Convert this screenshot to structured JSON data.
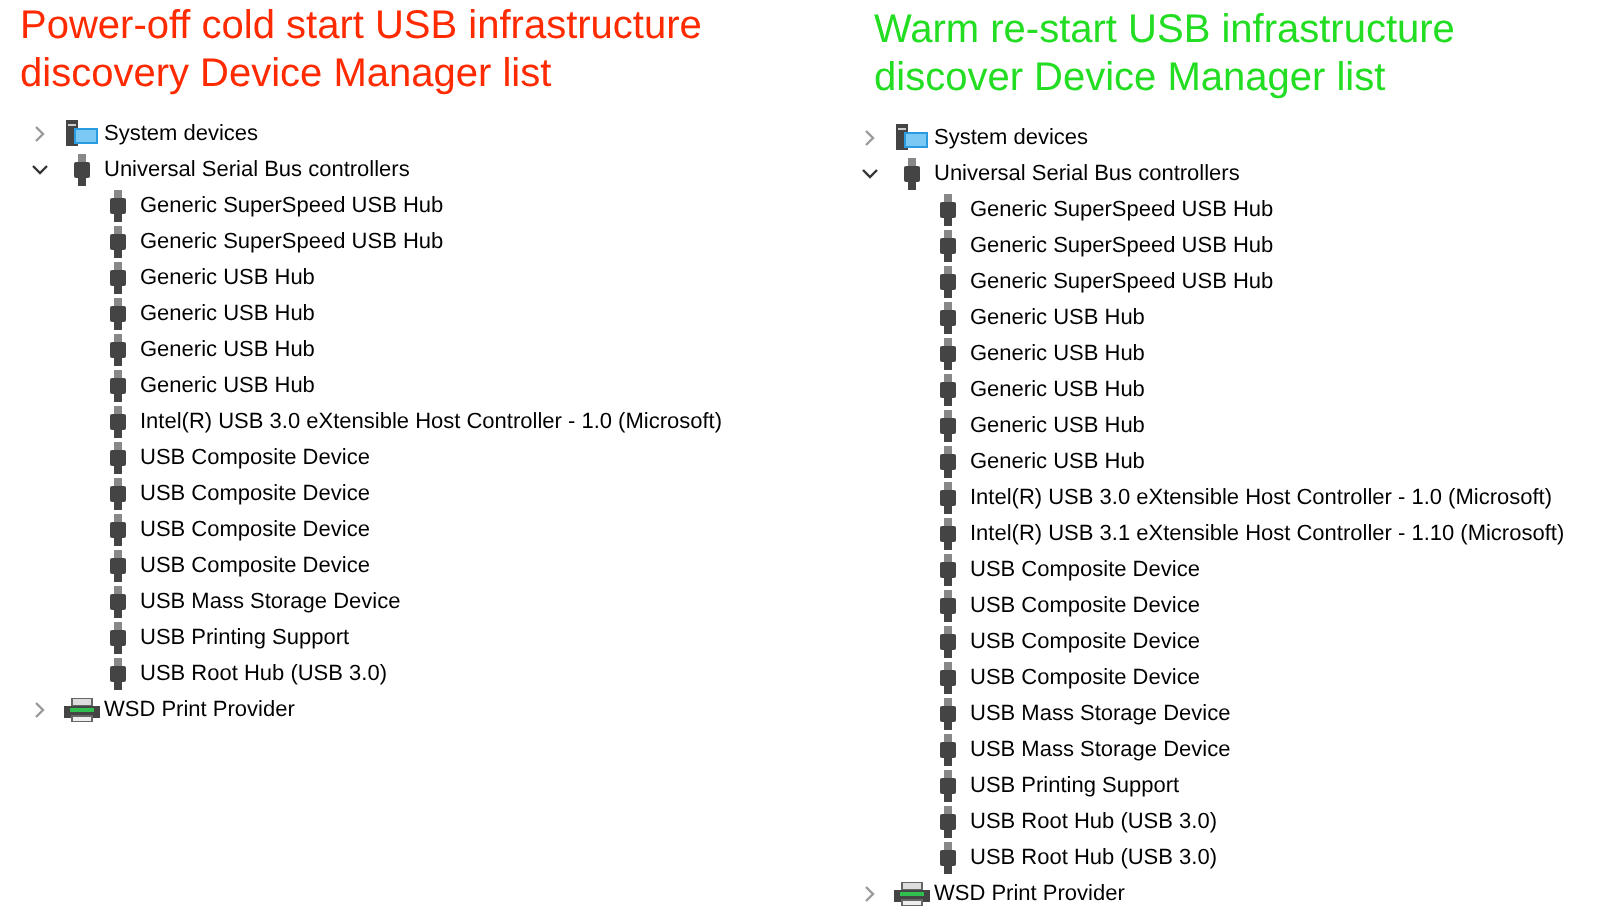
{
  "panels": [
    {
      "title": "Power-off cold start USB infrastructure discovery Device Manager list",
      "color": "#ff2a00",
      "tree": [
        {
          "label": "System devices",
          "kind": "computer",
          "expanded": false
        },
        {
          "label": "Universal Serial Bus controllers",
          "kind": "usb",
          "expanded": true,
          "children": [
            {
              "label": "Generic SuperSpeed USB Hub",
              "kind": "usb"
            },
            {
              "label": "Generic SuperSpeed USB Hub",
              "kind": "usb"
            },
            {
              "label": "Generic USB Hub",
              "kind": "usb"
            },
            {
              "label": "Generic USB Hub",
              "kind": "usb"
            },
            {
              "label": "Generic USB Hub",
              "kind": "usb"
            },
            {
              "label": "Generic USB Hub",
              "kind": "usb"
            },
            {
              "label": "Intel(R) USB 3.0 eXtensible Host Controller - 1.0 (Microsoft)",
              "kind": "usb"
            },
            {
              "label": "USB Composite Device",
              "kind": "usb"
            },
            {
              "label": "USB Composite Device",
              "kind": "usb"
            },
            {
              "label": "USB Composite Device",
              "kind": "usb"
            },
            {
              "label": "USB Composite Device",
              "kind": "usb"
            },
            {
              "label": "USB Mass Storage Device",
              "kind": "usb"
            },
            {
              "label": "USB Printing Support",
              "kind": "usb"
            },
            {
              "label": "USB Root Hub (USB 3.0)",
              "kind": "usb"
            }
          ]
        },
        {
          "label": "WSD Print Provider",
          "kind": "printer",
          "expanded": false
        }
      ]
    },
    {
      "title": "Warm re-start USB infrastructure discover Device Manager list",
      "color": "#22dd22",
      "tree": [
        {
          "label": "System devices",
          "kind": "computer",
          "expanded": false
        },
        {
          "label": "Universal Serial Bus controllers",
          "kind": "usb",
          "expanded": true,
          "children": [
            {
              "label": "Generic SuperSpeed USB Hub",
              "kind": "usb"
            },
            {
              "label": "Generic SuperSpeed USB Hub",
              "kind": "usb"
            },
            {
              "label": "Generic SuperSpeed USB Hub",
              "kind": "usb"
            },
            {
              "label": "Generic USB Hub",
              "kind": "usb"
            },
            {
              "label": "Generic USB Hub",
              "kind": "usb"
            },
            {
              "label": "Generic USB Hub",
              "kind": "usb"
            },
            {
              "label": "Generic USB Hub",
              "kind": "usb"
            },
            {
              "label": "Generic USB Hub",
              "kind": "usb"
            },
            {
              "label": "Intel(R) USB 3.0 eXtensible Host Controller - 1.0 (Microsoft)",
              "kind": "usb"
            },
            {
              "label": "Intel(R) USB 3.1 eXtensible Host Controller - 1.10 (Microsoft)",
              "kind": "usb"
            },
            {
              "label": "USB Composite Device",
              "kind": "usb"
            },
            {
              "label": "USB Composite Device",
              "kind": "usb"
            },
            {
              "label": "USB Composite Device",
              "kind": "usb"
            },
            {
              "label": "USB Composite Device",
              "kind": "usb"
            },
            {
              "label": "USB Mass Storage Device",
              "kind": "usb"
            },
            {
              "label": "USB Mass Storage Device",
              "kind": "usb"
            },
            {
              "label": "USB Printing Support",
              "kind": "usb"
            },
            {
              "label": "USB Root Hub (USB 3.0)",
              "kind": "usb"
            },
            {
              "label": "USB Root Hub (USB 3.0)",
              "kind": "usb"
            }
          ]
        },
        {
          "label": "WSD Print Provider",
          "kind": "printer",
          "expanded": false
        }
      ]
    }
  ]
}
